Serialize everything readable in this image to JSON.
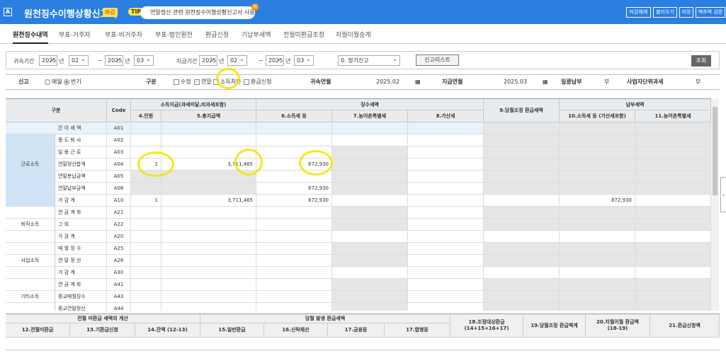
{
  "title_bar": {
    "title": "원천징수이행상황신고서",
    "badge": "마감",
    "tip_label": "TIP",
    "notice": "연말정산 관련 원천징수이행상황신고서 사용방법...",
    "notice_count": "N",
    "buttons": [
      "마감해제",
      "불러오기",
      "저장",
      "엑추력 검증"
    ]
  },
  "tabs": [
    "원천징수내역",
    "부표-거주자",
    "부표-비거주자",
    "부표-법인원천",
    "환급신청",
    "기납부세액",
    "전월미환급조정",
    "차월이월승계"
  ],
  "filter": {
    "belong_label": "귀속기간",
    "belong_from_year": "2025",
    "belong_from_month": "02",
    "belong_to_year": "2025",
    "belong_to_month": "03",
    "pay_label": "지급기간",
    "pay_from_year": "2025",
    "pay_from_month": "02",
    "pay_to_year": "2025",
    "pay_to_month": "03",
    "year_unit": "년",
    "month_unit": "월",
    "tilde": "~",
    "report_type": "0. 정기신고",
    "list_button": "신고리스트",
    "view_button": "조회"
  },
  "info": {
    "report_label": "신고",
    "opt_monthly": "매월",
    "opt_half": "반기",
    "category_label": "구분",
    "chk_amend": "수정",
    "chk_yearend": "연말",
    "chk_income": "소득처분",
    "chk_refund": "환급신청",
    "belong_ym_label": "귀속연월",
    "belong_ym": "2025.02",
    "pay_ym_label": "지급연월",
    "pay_ym": "2025.03",
    "lump_label": "일괄납부",
    "lump_value": "부",
    "unit_label": "사업자단위과세",
    "unit_value": "부"
  },
  "grid": {
    "h_category": "구분",
    "h_code": "Code",
    "h_income_group": "소득지급(과세미달,비과세포함)",
    "h_people": "4.인원",
    "h_total": "5.총지급액",
    "h_withheld_group": "징수세액",
    "h_income_tax": "6.소득세 등",
    "h_rural": "7.농어촌특별세",
    "h_penalty": "8.가산세",
    "h_adjust": "9.당월조정 환급세액",
    "h_paid_group": "납부세액",
    "h_paid_income": "10.소득세 등 (가산세포함)",
    "h_paid_rural": "11.농어촌특별세",
    "groups": [
      "근로소득",
      "퇴직소득",
      "사업소득",
      "기타소득"
    ],
    "rows": [
      {
        "name": "간 이 세 액",
        "code": "A01",
        "people": "",
        "total": "",
        "tax": "",
        "rural": "",
        "penalty": "",
        "adjust": "",
        "paid": "",
        "paid_rural": ""
      },
      {
        "name": "중 도 퇴 사",
        "code": "A02",
        "people": "",
        "total": "",
        "tax": "",
        "rural": "",
        "penalty": "",
        "adjust": "",
        "paid": "",
        "paid_rural": ""
      },
      {
        "name": "일 용 근 로",
        "code": "A03",
        "people": "",
        "total": "",
        "tax": "",
        "rural": "",
        "penalty": "",
        "adjust": "",
        "paid": "",
        "paid_rural": ""
      },
      {
        "name": "연말정산합계",
        "code": "A04",
        "people": "1",
        "total": "3,711,465",
        "tax": "872,930",
        "rural": "",
        "penalty": "",
        "adjust": "",
        "paid": "",
        "paid_rural": ""
      },
      {
        "name": "연말분납금액",
        "code": "A05",
        "people": "",
        "total": "",
        "tax": "",
        "rural": "",
        "penalty": "",
        "adjust": "",
        "paid": "",
        "paid_rural": ""
      },
      {
        "name": "연말납부금액",
        "code": "A06",
        "people": "",
        "total": "",
        "tax": "872,930",
        "rural": "",
        "penalty": "",
        "adjust": "",
        "paid": "",
        "paid_rural": ""
      },
      {
        "name": "가 감 계",
        "code": "A10",
        "people": "1",
        "total": "3,711,465",
        "tax": "872,930",
        "rural": "",
        "penalty": "",
        "adjust": "",
        "paid": "872,930",
        "paid_rural": ""
      },
      {
        "name": "연 금 계 좌",
        "code": "A21",
        "people": "",
        "total": "",
        "tax": "",
        "rural": "",
        "penalty": "",
        "adjust": "",
        "paid": "",
        "paid_rural": ""
      },
      {
        "name": "그 외",
        "code": "A22",
        "people": "",
        "total": "",
        "tax": "",
        "rural": "",
        "penalty": "",
        "adjust": "",
        "paid": "",
        "paid_rural": ""
      },
      {
        "name": "가 감 계",
        "code": "A20",
        "people": "",
        "total": "",
        "tax": "",
        "rural": "",
        "penalty": "",
        "adjust": "",
        "paid": "",
        "paid_rural": ""
      },
      {
        "name": "매 월 징 수",
        "code": "A25",
        "people": "",
        "total": "",
        "tax": "",
        "rural": "",
        "penalty": "",
        "adjust": "",
        "paid": "",
        "paid_rural": ""
      },
      {
        "name": "연 말 정 산",
        "code": "A26",
        "people": "",
        "total": "",
        "tax": "",
        "rural": "",
        "penalty": "",
        "adjust": "",
        "paid": "",
        "paid_rural": ""
      },
      {
        "name": "가 감 계",
        "code": "A30",
        "people": "",
        "total": "",
        "tax": "",
        "rural": "",
        "penalty": "",
        "adjust": "",
        "paid": "",
        "paid_rural": ""
      },
      {
        "name": "연 금 계 좌",
        "code": "A41",
        "people": "",
        "total": "",
        "tax": "",
        "rural": "",
        "penalty": "",
        "adjust": "",
        "paid": "",
        "paid_rural": ""
      },
      {
        "name": "종교매월징수",
        "code": "A43",
        "people": "",
        "total": "",
        "tax": "",
        "rural": "",
        "penalty": "",
        "adjust": "",
        "paid": "",
        "paid_rural": ""
      },
      {
        "name": "종교연말정산",
        "code": "A44",
        "people": "",
        "total": "",
        "tax": "",
        "rural": "",
        "penalty": "",
        "adjust": "",
        "paid": "",
        "paid_rural": ""
      }
    ]
  },
  "bottom": {
    "g1": "전월 미환급 세액의 계산",
    "g2": "당월 발생 환급세액",
    "h12": "12.전월미환급",
    "h13": "13.기환급신청",
    "h14": "14.잔액 (12-13)",
    "h15": "15.일반환급",
    "h16": "16.신탁재산",
    "h17": "17.금융등",
    "h17b": "17.합병등",
    "h18a": "18.조정대상환급",
    "h18b": "(14+15+16+17)",
    "h19": "19.당월조정 환급액계",
    "h20a": "20.차월이월 환급액",
    "h20b": "(18-19)",
    "h21": "21.환급신청액"
  },
  "colors": {
    "title_bar": "#2a7fe0",
    "highlight_circle": "#f5e600",
    "selected_group": "#cfe5f7"
  }
}
